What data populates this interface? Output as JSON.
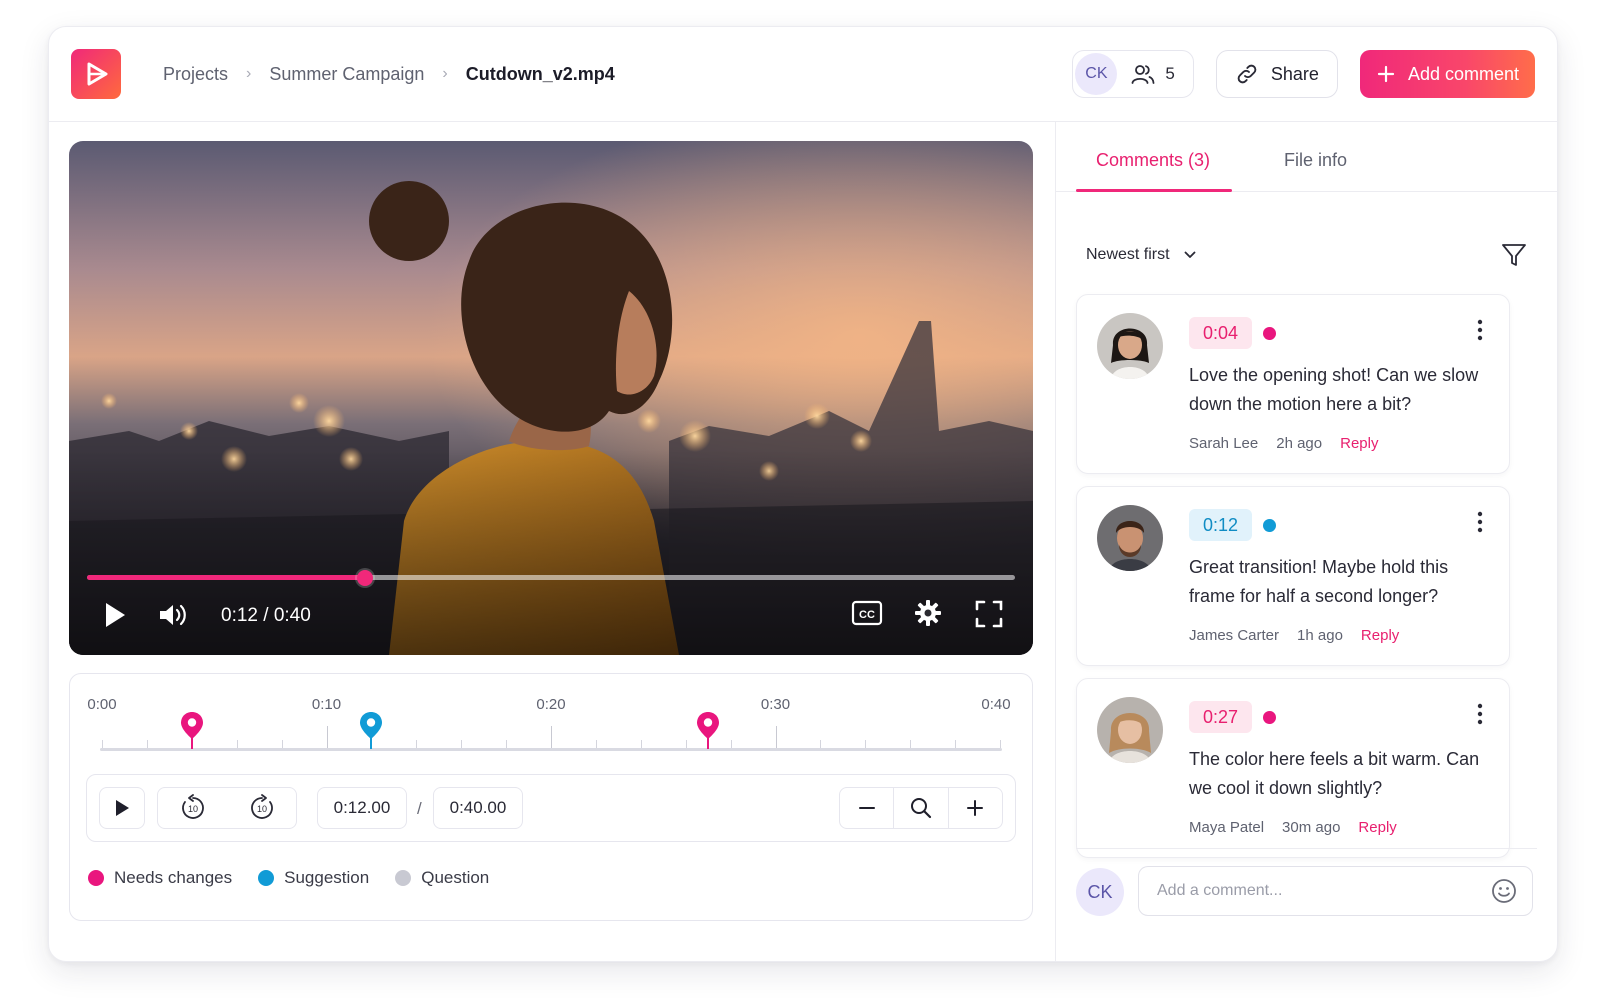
{
  "colors": {
    "accent": "#f0287a",
    "needs_changes": "#e9167e",
    "suggestion": "#119bd6",
    "question": "#c8c9d2"
  },
  "header": {
    "breadcrumbs": [
      "Projects",
      "Summer Campaign",
      "Cutdown_v2.mp4"
    ],
    "user_initials": "CK",
    "collaborator_count": "5",
    "share_label": "Share",
    "add_comment_label": "Add comment"
  },
  "player": {
    "time_display": "0:12 / 0:40",
    "progress": 0.3
  },
  "timeline": {
    "ticks": [
      "0:00",
      "0:10",
      "0:20",
      "0:30",
      "0:40"
    ],
    "markers": [
      {
        "time": 4,
        "type": "needs_changes"
      },
      {
        "time": 12,
        "type": "suggestion"
      },
      {
        "time": 27,
        "type": "needs_changes"
      }
    ],
    "current_time": "0:12.00",
    "duration": "0:40.00",
    "separator": "/"
  },
  "legend": [
    {
      "label": "Needs changes",
      "type": "needs_changes"
    },
    {
      "label": "Suggestion",
      "type": "suggestion"
    },
    {
      "label": "Question",
      "type": "question"
    }
  ],
  "panel": {
    "tabs": [
      "Comments (3)",
      "File info"
    ],
    "sort_label": "Newest first",
    "comments": [
      {
        "timestamp": "0:04",
        "type": "needs_changes",
        "text": "Love the opening shot! Can we slow down the motion here a bit?",
        "author": "Sarah Lee",
        "time_ago": "2h ago",
        "reply": "Reply"
      },
      {
        "timestamp": "0:12",
        "type": "suggestion",
        "text": "Great transition! Maybe hold this frame for half a second longer?",
        "author": "James Carter",
        "time_ago": "1h ago",
        "reply": "Reply"
      },
      {
        "timestamp": "0:27",
        "type": "needs_changes",
        "text": "The color here feels a bit warm. Can we cool it down slightly?",
        "author": "Maya Patel",
        "time_ago": "30m ago",
        "reply": "Reply"
      }
    ],
    "composer_placeholder": "Add a comment..."
  }
}
